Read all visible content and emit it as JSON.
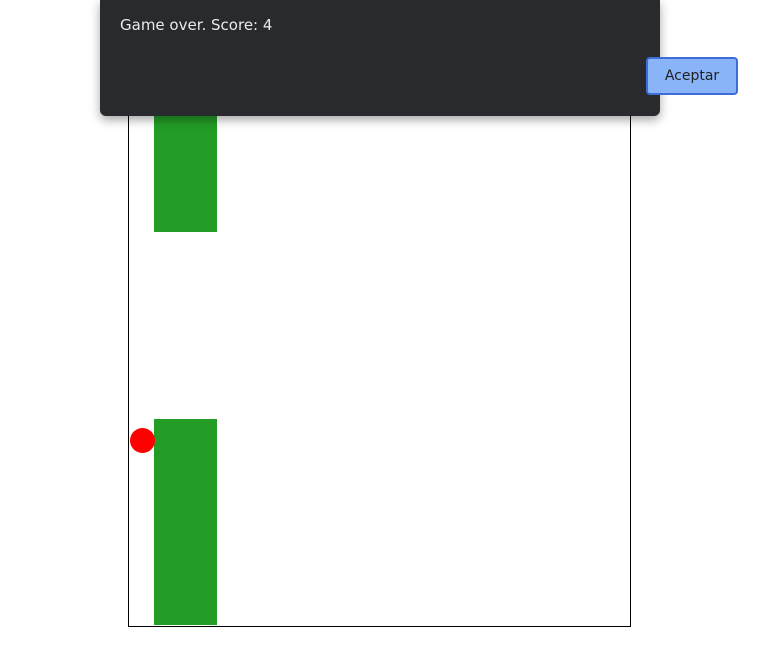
{
  "game": {
    "score": 4,
    "colors": {
      "pipe": "#239d26",
      "ball": "#ff0000",
      "background": "#ffffff",
      "border": "#000000"
    }
  },
  "dialog": {
    "message": "Game over. Score: 4",
    "ok_label": "Aceptar",
    "colors": {
      "background": "#292a2d",
      "text": "#e8eaed",
      "button_bg": "#8ab4f8",
      "button_border": "#3b6fd6"
    }
  }
}
